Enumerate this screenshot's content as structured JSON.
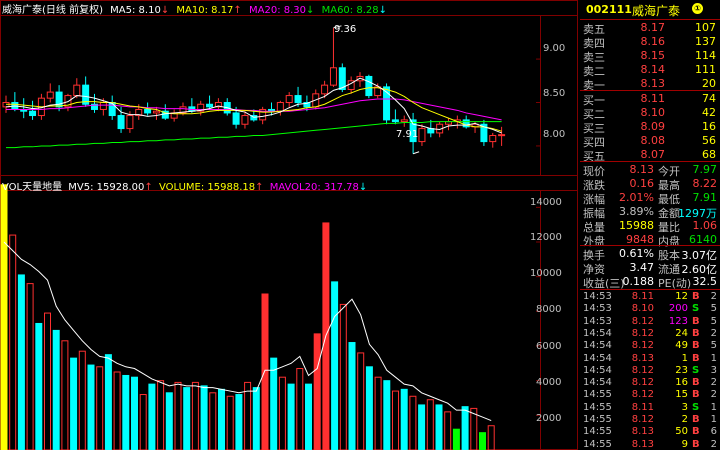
{
  "colors": {
    "up": "#ff3030",
    "down": "#00ffff",
    "ma5": "#ffffff",
    "ma10": "#ffff00",
    "ma20": "#ff00ff",
    "ma60": "#00ff00",
    "grid": "#800000",
    "bg": "#000000"
  },
  "header": {
    "stock_label": "威海广泰(日线 前复权)",
    "ma5_label": "MA5: 8.10",
    "ma10_label": "MA10: 8.17",
    "ma20_label": "MA20: 8.30",
    "ma60_label": "MA60: 8.28",
    "ma5_arrow": "↓",
    "ma10_arrow": "↑",
    "ma20_arrow": "↓",
    "ma60_arrow": "↓"
  },
  "price_axis": {
    "labels": [
      "9.00",
      "8.50",
      "8.00"
    ],
    "values": [
      9.0,
      8.5,
      8.0
    ],
    "min": 7.7,
    "max": 9.45
  },
  "high_annotation": "9.36",
  "low_annotation": "7.91",
  "volume_header": {
    "title": "VOL天量地量",
    "mv5_label": "MV5: 15928.00",
    "mv5_arrow": "↑",
    "volume_label": "VOLUME: 15988.18",
    "volume_arrow": "↑",
    "mavol20_label": "MAVOL20: 317.78",
    "mavol20_arrow": "↓"
  },
  "volume_axis": {
    "labels": [
      "14000",
      "12000",
      "10000",
      "8000",
      "6000",
      "4000",
      "2000"
    ],
    "values": [
      14000,
      12000,
      10000,
      8000,
      6000,
      4000,
      2000
    ],
    "max": 15000
  },
  "chart_data": {
    "type": "candlestick",
    "candles": [
      {
        "o": 8.45,
        "h": 8.58,
        "l": 8.38,
        "c": 8.5
      },
      {
        "o": 8.5,
        "h": 8.62,
        "l": 8.4,
        "c": 8.42
      },
      {
        "o": 8.42,
        "h": 8.55,
        "l": 8.32,
        "c": 8.4
      },
      {
        "o": 8.4,
        "h": 8.52,
        "l": 8.3,
        "c": 8.35
      },
      {
        "o": 8.35,
        "h": 8.6,
        "l": 8.3,
        "c": 8.55
      },
      {
        "o": 8.55,
        "h": 8.72,
        "l": 8.5,
        "c": 8.62
      },
      {
        "o": 8.62,
        "h": 8.7,
        "l": 8.4,
        "c": 8.45
      },
      {
        "o": 8.45,
        "h": 8.6,
        "l": 8.4,
        "c": 8.58
      },
      {
        "o": 8.58,
        "h": 8.78,
        "l": 8.55,
        "c": 8.7
      },
      {
        "o": 8.7,
        "h": 8.8,
        "l": 8.45,
        "c": 8.48
      },
      {
        "o": 8.48,
        "h": 8.6,
        "l": 8.38,
        "c": 8.42
      },
      {
        "o": 8.42,
        "h": 8.55,
        "l": 8.35,
        "c": 8.5
      },
      {
        "o": 8.5,
        "h": 8.58,
        "l": 8.3,
        "c": 8.35
      },
      {
        "o": 8.35,
        "h": 8.45,
        "l": 8.15,
        "c": 8.2
      },
      {
        "o": 8.2,
        "h": 8.4,
        "l": 8.15,
        "c": 8.35
      },
      {
        "o": 8.35,
        "h": 8.48,
        "l": 8.3,
        "c": 8.42
      },
      {
        "o": 8.42,
        "h": 8.5,
        "l": 8.35,
        "c": 8.38
      },
      {
        "o": 8.38,
        "h": 8.45,
        "l": 8.3,
        "c": 8.4
      },
      {
        "o": 8.4,
        "h": 8.48,
        "l": 8.3,
        "c": 8.32
      },
      {
        "o": 8.32,
        "h": 8.42,
        "l": 8.28,
        "c": 8.38
      },
      {
        "o": 8.38,
        "h": 8.5,
        "l": 8.35,
        "c": 8.45
      },
      {
        "o": 8.45,
        "h": 8.55,
        "l": 8.38,
        "c": 8.4
      },
      {
        "o": 8.4,
        "h": 8.52,
        "l": 8.35,
        "c": 8.48
      },
      {
        "o": 8.48,
        "h": 8.58,
        "l": 8.42,
        "c": 8.45
      },
      {
        "o": 8.45,
        "h": 8.55,
        "l": 8.4,
        "c": 8.5
      },
      {
        "o": 8.5,
        "h": 8.55,
        "l": 8.35,
        "c": 8.38
      },
      {
        "o": 8.38,
        "h": 8.45,
        "l": 8.2,
        "c": 8.25
      },
      {
        "o": 8.25,
        "h": 8.4,
        "l": 8.2,
        "c": 8.35
      },
      {
        "o": 8.35,
        "h": 8.42,
        "l": 8.28,
        "c": 8.3
      },
      {
        "o": 8.3,
        "h": 8.45,
        "l": 8.25,
        "c": 8.42
      },
      {
        "o": 8.42,
        "h": 8.5,
        "l": 8.35,
        "c": 8.4
      },
      {
        "o": 8.4,
        "h": 8.52,
        "l": 8.35,
        "c": 8.5
      },
      {
        "o": 8.5,
        "h": 8.62,
        "l": 8.45,
        "c": 8.58
      },
      {
        "o": 8.58,
        "h": 8.68,
        "l": 8.45,
        "c": 8.5
      },
      {
        "o": 8.5,
        "h": 8.58,
        "l": 8.4,
        "c": 8.45
      },
      {
        "o": 8.45,
        "h": 8.65,
        "l": 8.42,
        "c": 8.6
      },
      {
        "o": 8.6,
        "h": 8.75,
        "l": 8.55,
        "c": 8.7
      },
      {
        "o": 8.7,
        "h": 9.36,
        "l": 8.68,
        "c": 8.9
      },
      {
        "o": 8.9,
        "h": 8.95,
        "l": 8.62,
        "c": 8.65
      },
      {
        "o": 8.65,
        "h": 8.8,
        "l": 8.6,
        "c": 8.75
      },
      {
        "o": 8.75,
        "h": 8.85,
        "l": 8.68,
        "c": 8.8
      },
      {
        "o": 8.8,
        "h": 8.82,
        "l": 8.55,
        "c": 8.58
      },
      {
        "o": 8.58,
        "h": 8.72,
        "l": 8.55,
        "c": 8.68
      },
      {
        "o": 8.68,
        "h": 8.72,
        "l": 8.25,
        "c": 8.3
      },
      {
        "o": 8.3,
        "h": 8.42,
        "l": 8.25,
        "c": 8.28
      },
      {
        "o": 8.28,
        "h": 8.35,
        "l": 8.22,
        "c": 8.3
      },
      {
        "o": 8.3,
        "h": 8.38,
        "l": 7.91,
        "c": 8.05
      },
      {
        "o": 8.05,
        "h": 8.25,
        "l": 8.0,
        "c": 8.2
      },
      {
        "o": 8.2,
        "h": 8.3,
        "l": 8.1,
        "c": 8.15
      },
      {
        "o": 8.15,
        "h": 8.28,
        "l": 8.1,
        "c": 8.25
      },
      {
        "o": 8.25,
        "h": 8.32,
        "l": 8.18,
        "c": 8.28
      },
      {
        "o": 8.28,
        "h": 8.35,
        "l": 8.2,
        "c": 8.3
      },
      {
        "o": 8.3,
        "h": 8.35,
        "l": 8.2,
        "c": 8.22
      },
      {
        "o": 8.22,
        "h": 8.28,
        "l": 8.15,
        "c": 8.25
      },
      {
        "o": 8.25,
        "h": 8.3,
        "l": 8.0,
        "c": 8.05
      },
      {
        "o": 8.05,
        "h": 8.15,
        "l": 7.98,
        "c": 8.12
      },
      {
        "o": 8.12,
        "h": 8.22,
        "l": 8.0,
        "c": 8.13
      }
    ],
    "ma5": [
      8.45,
      8.46,
      8.45,
      8.43,
      8.44,
      8.47,
      8.48,
      8.51,
      8.58,
      8.57,
      8.55,
      8.52,
      8.49,
      8.39,
      8.36,
      8.36,
      8.34,
      8.35,
      8.37,
      8.38,
      8.39,
      8.4,
      8.41,
      8.43,
      8.46,
      8.44,
      8.41,
      8.39,
      8.33,
      8.34,
      8.36,
      8.39,
      8.44,
      8.48,
      8.49,
      8.53,
      8.57,
      8.64,
      8.67,
      8.72,
      8.78,
      8.74,
      8.69,
      8.62,
      8.53,
      8.43,
      8.25,
      8.23,
      8.2,
      8.19,
      8.23,
      8.24,
      8.24,
      8.26,
      8.22,
      8.19,
      8.15
    ],
    "ma10": [
      8.48,
      8.48,
      8.47,
      8.46,
      8.45,
      8.46,
      8.46,
      8.47,
      8.5,
      8.51,
      8.51,
      8.5,
      8.5,
      8.48,
      8.46,
      8.45,
      8.43,
      8.42,
      8.38,
      8.37,
      8.37,
      8.37,
      8.38,
      8.4,
      8.41,
      8.41,
      8.41,
      8.41,
      8.4,
      8.39,
      8.39,
      8.4,
      8.41,
      8.42,
      8.44,
      8.45,
      8.48,
      8.53,
      8.58,
      8.61,
      8.65,
      8.67,
      8.67,
      8.65,
      8.62,
      8.57,
      8.5,
      8.44,
      8.4,
      8.36,
      8.32,
      8.28,
      8.24,
      8.22,
      8.22,
      8.2,
      8.17
    ],
    "ma20": [
      8.42,
      8.42,
      8.42,
      8.42,
      8.42,
      8.43,
      8.43,
      8.44,
      8.45,
      8.46,
      8.47,
      8.47,
      8.47,
      8.46,
      8.45,
      8.45,
      8.44,
      8.44,
      8.43,
      8.43,
      8.43,
      8.42,
      8.42,
      8.42,
      8.42,
      8.42,
      8.42,
      8.41,
      8.41,
      8.4,
      8.4,
      8.4,
      8.4,
      8.41,
      8.42,
      8.43,
      8.44,
      8.46,
      8.48,
      8.5,
      8.52,
      8.53,
      8.54,
      8.54,
      8.54,
      8.53,
      8.51,
      8.49,
      8.47,
      8.45,
      8.43,
      8.41,
      8.38,
      8.36,
      8.34,
      8.32,
      8.3
    ],
    "ma60": [
      7.98,
      7.98,
      7.99,
      7.99,
      8.0,
      8.0,
      8.01,
      8.01,
      8.02,
      8.02,
      8.03,
      8.03,
      8.04,
      8.04,
      8.05,
      8.05,
      8.06,
      8.06,
      8.07,
      8.07,
      8.08,
      8.08,
      8.09,
      8.09,
      8.1,
      8.1,
      8.11,
      8.11,
      8.12,
      8.12,
      8.13,
      8.14,
      8.15,
      8.16,
      8.17,
      8.18,
      8.19,
      8.2,
      8.21,
      8.22,
      8.23,
      8.24,
      8.25,
      8.26,
      8.26,
      8.27,
      8.27,
      8.27,
      8.28,
      8.28,
      8.28,
      8.28,
      8.28,
      8.28,
      8.28,
      8.28,
      8.28
    ],
    "volumes": [
      15300,
      12400,
      10100,
      9600,
      7300,
      7900,
      6900,
      6300,
      5300,
      5700,
      4900,
      4800,
      5500,
      4500,
      4300,
      4200,
      3200,
      3800,
      4000,
      3300,
      3900,
      3600,
      3900,
      3700,
      3300,
      3500,
      3100,
      3200,
      3900,
      3600,
      9000,
      5300,
      4200,
      3800,
      4700,
      3800,
      6700,
      13100,
      9700,
      8400,
      6200,
      5600,
      4800,
      4200,
      4000,
      3400,
      3500,
      3100,
      2600,
      2900,
      2600,
      2200,
      1200,
      2500,
      2400,
      1000,
      1400
    ],
    "vol_colors": [
      "yellow",
      "up",
      "down",
      "up",
      "down",
      "up",
      "down",
      "up",
      "down",
      "up",
      "down",
      "up",
      "down",
      "up",
      "down",
      "down",
      "up",
      "down",
      "up",
      "down",
      "up",
      "down",
      "up",
      "down",
      "up",
      "down",
      "up",
      "down",
      "up",
      "down",
      "upfill",
      "down",
      "up",
      "down",
      "up",
      "down",
      "upfill",
      "upfill",
      "down",
      "up",
      "down",
      "up",
      "down",
      "up",
      "down",
      "up",
      "down",
      "up",
      "down",
      "up",
      "down",
      "up",
      "green",
      "down",
      "up",
      "green",
      "up"
    ],
    "mv5": [
      12000,
      11500,
      11000,
      10700,
      10300,
      9800,
      8300,
      7500,
      6900,
      6300,
      5800,
      5400,
      5300,
      5000,
      4800,
      4700,
      4400,
      4100,
      3900,
      3700,
      3800,
      3700,
      3700,
      3600,
      3600,
      3500,
      3400,
      3300,
      3400,
      3400,
      4600,
      4600,
      4800,
      5000,
      5400,
      4300,
      4700,
      6600,
      7700,
      8200,
      8700,
      7800,
      6100,
      5500,
      4600,
      4200,
      3800,
      3700,
      3300,
      3100,
      2900,
      2700,
      2300,
      2300,
      2100,
      1900,
      1700
    ]
  },
  "right_panel": {
    "code": "002111",
    "name": "威海广泰",
    "badge": "①",
    "sells": [
      {
        "label": "卖五",
        "price": "8.17",
        "vol": "107"
      },
      {
        "label": "卖四",
        "price": "8.16",
        "vol": "137"
      },
      {
        "label": "卖三",
        "price": "8.15",
        "vol": "114"
      },
      {
        "label": "卖二",
        "price": "8.14",
        "vol": "111"
      },
      {
        "label": "卖一",
        "price": "8.13",
        "vol": "20"
      }
    ],
    "buys": [
      {
        "label": "买一",
        "price": "8.11",
        "vol": "74"
      },
      {
        "label": "买二",
        "price": "8.10",
        "vol": "42"
      },
      {
        "label": "买三",
        "price": "8.09",
        "vol": "16"
      },
      {
        "label": "买四",
        "price": "8.08",
        "vol": "56"
      },
      {
        "label": "买五",
        "price": "8.07",
        "vol": "68"
      }
    ],
    "quotes": [
      {
        "l1": "现价",
        "v1": "8.13",
        "c1": "red",
        "l2": "今开",
        "v2": "7.97",
        "c2": "green"
      },
      {
        "l1": "涨跌",
        "v1": "0.16",
        "c1": "red",
        "l2": "最高",
        "v2": "8.22",
        "c2": "red"
      },
      {
        "l1": "涨幅",
        "v1": "2.01%",
        "c1": "red",
        "l2": "最低",
        "v2": "7.91",
        "c2": "green"
      },
      {
        "l1": "振幅",
        "v1": "3.89%",
        "c1": "gray",
        "l2": "金额",
        "v2": "1297万",
        "c2": "cyan"
      },
      {
        "l1": "总量",
        "v1": "15988",
        "c1": "yellow",
        "l2": "量比",
        "v2": "1.06",
        "c2": "red"
      },
      {
        "l1": "外盘",
        "v1": "9848",
        "c1": "red",
        "l2": "内盘",
        "v2": "6140",
        "c2": "green"
      }
    ],
    "fundamentals": [
      {
        "l1": "换手",
        "v1": "0.61%",
        "l2": "股本",
        "v2": "3.07亿"
      },
      {
        "l1": "净资",
        "v1": "3.47",
        "l2": "流通",
        "v2": "2.60亿"
      },
      {
        "l1": "收益(三)",
        "v1": "0.188",
        "l2": "PE(动)",
        "v2": "32.5"
      }
    ],
    "ticks": [
      {
        "time": "14:53",
        "price": "8.11",
        "pc": "red",
        "vol": "12",
        "vc": "yellow",
        "flag": "B",
        "fc": "red",
        "cnt": "2"
      },
      {
        "time": "14:53",
        "price": "8.10",
        "pc": "red",
        "vol": "200",
        "vc": "magenta",
        "flag": "S",
        "fc": "green",
        "cnt": "5"
      },
      {
        "time": "14:53",
        "price": "8.12",
        "pc": "red",
        "vol": "123",
        "vc": "magenta",
        "flag": "B",
        "fc": "red",
        "cnt": "5"
      },
      {
        "time": "14:54",
        "price": "8.12",
        "pc": "red",
        "vol": "24",
        "vc": "yellow",
        "flag": "B",
        "fc": "red",
        "cnt": "2"
      },
      {
        "time": "14:54",
        "price": "8.12",
        "pc": "red",
        "vol": "49",
        "vc": "yellow",
        "flag": "B",
        "fc": "red",
        "cnt": "5"
      },
      {
        "time": "14:54",
        "price": "8.13",
        "pc": "red",
        "vol": "1",
        "vc": "yellow",
        "flag": "B",
        "fc": "red",
        "cnt": "1"
      },
      {
        "time": "14:54",
        "price": "8.12",
        "pc": "red",
        "vol": "23",
        "vc": "yellow",
        "flag": "S",
        "fc": "green",
        "cnt": "3"
      },
      {
        "time": "14:54",
        "price": "8.12",
        "pc": "red",
        "vol": "16",
        "vc": "yellow",
        "flag": "B",
        "fc": "red",
        "cnt": "2"
      },
      {
        "time": "14:55",
        "price": "8.12",
        "pc": "red",
        "vol": "15",
        "vc": "yellow",
        "flag": "B",
        "fc": "red",
        "cnt": "2"
      },
      {
        "time": "14:55",
        "price": "8.11",
        "pc": "red",
        "vol": "3",
        "vc": "yellow",
        "flag": "S",
        "fc": "green",
        "cnt": "1"
      },
      {
        "time": "14:55",
        "price": "8.12",
        "pc": "red",
        "vol": "2",
        "vc": "yellow",
        "flag": "B",
        "fc": "red",
        "cnt": "1"
      },
      {
        "time": "14:55",
        "price": "8.13",
        "pc": "red",
        "vol": "50",
        "vc": "yellow",
        "flag": "B",
        "fc": "red",
        "cnt": "6"
      },
      {
        "time": "14:55",
        "price": "8.13",
        "pc": "red",
        "vol": "9",
        "vc": "yellow",
        "flag": "B",
        "fc": "red",
        "cnt": "2"
      }
    ]
  }
}
